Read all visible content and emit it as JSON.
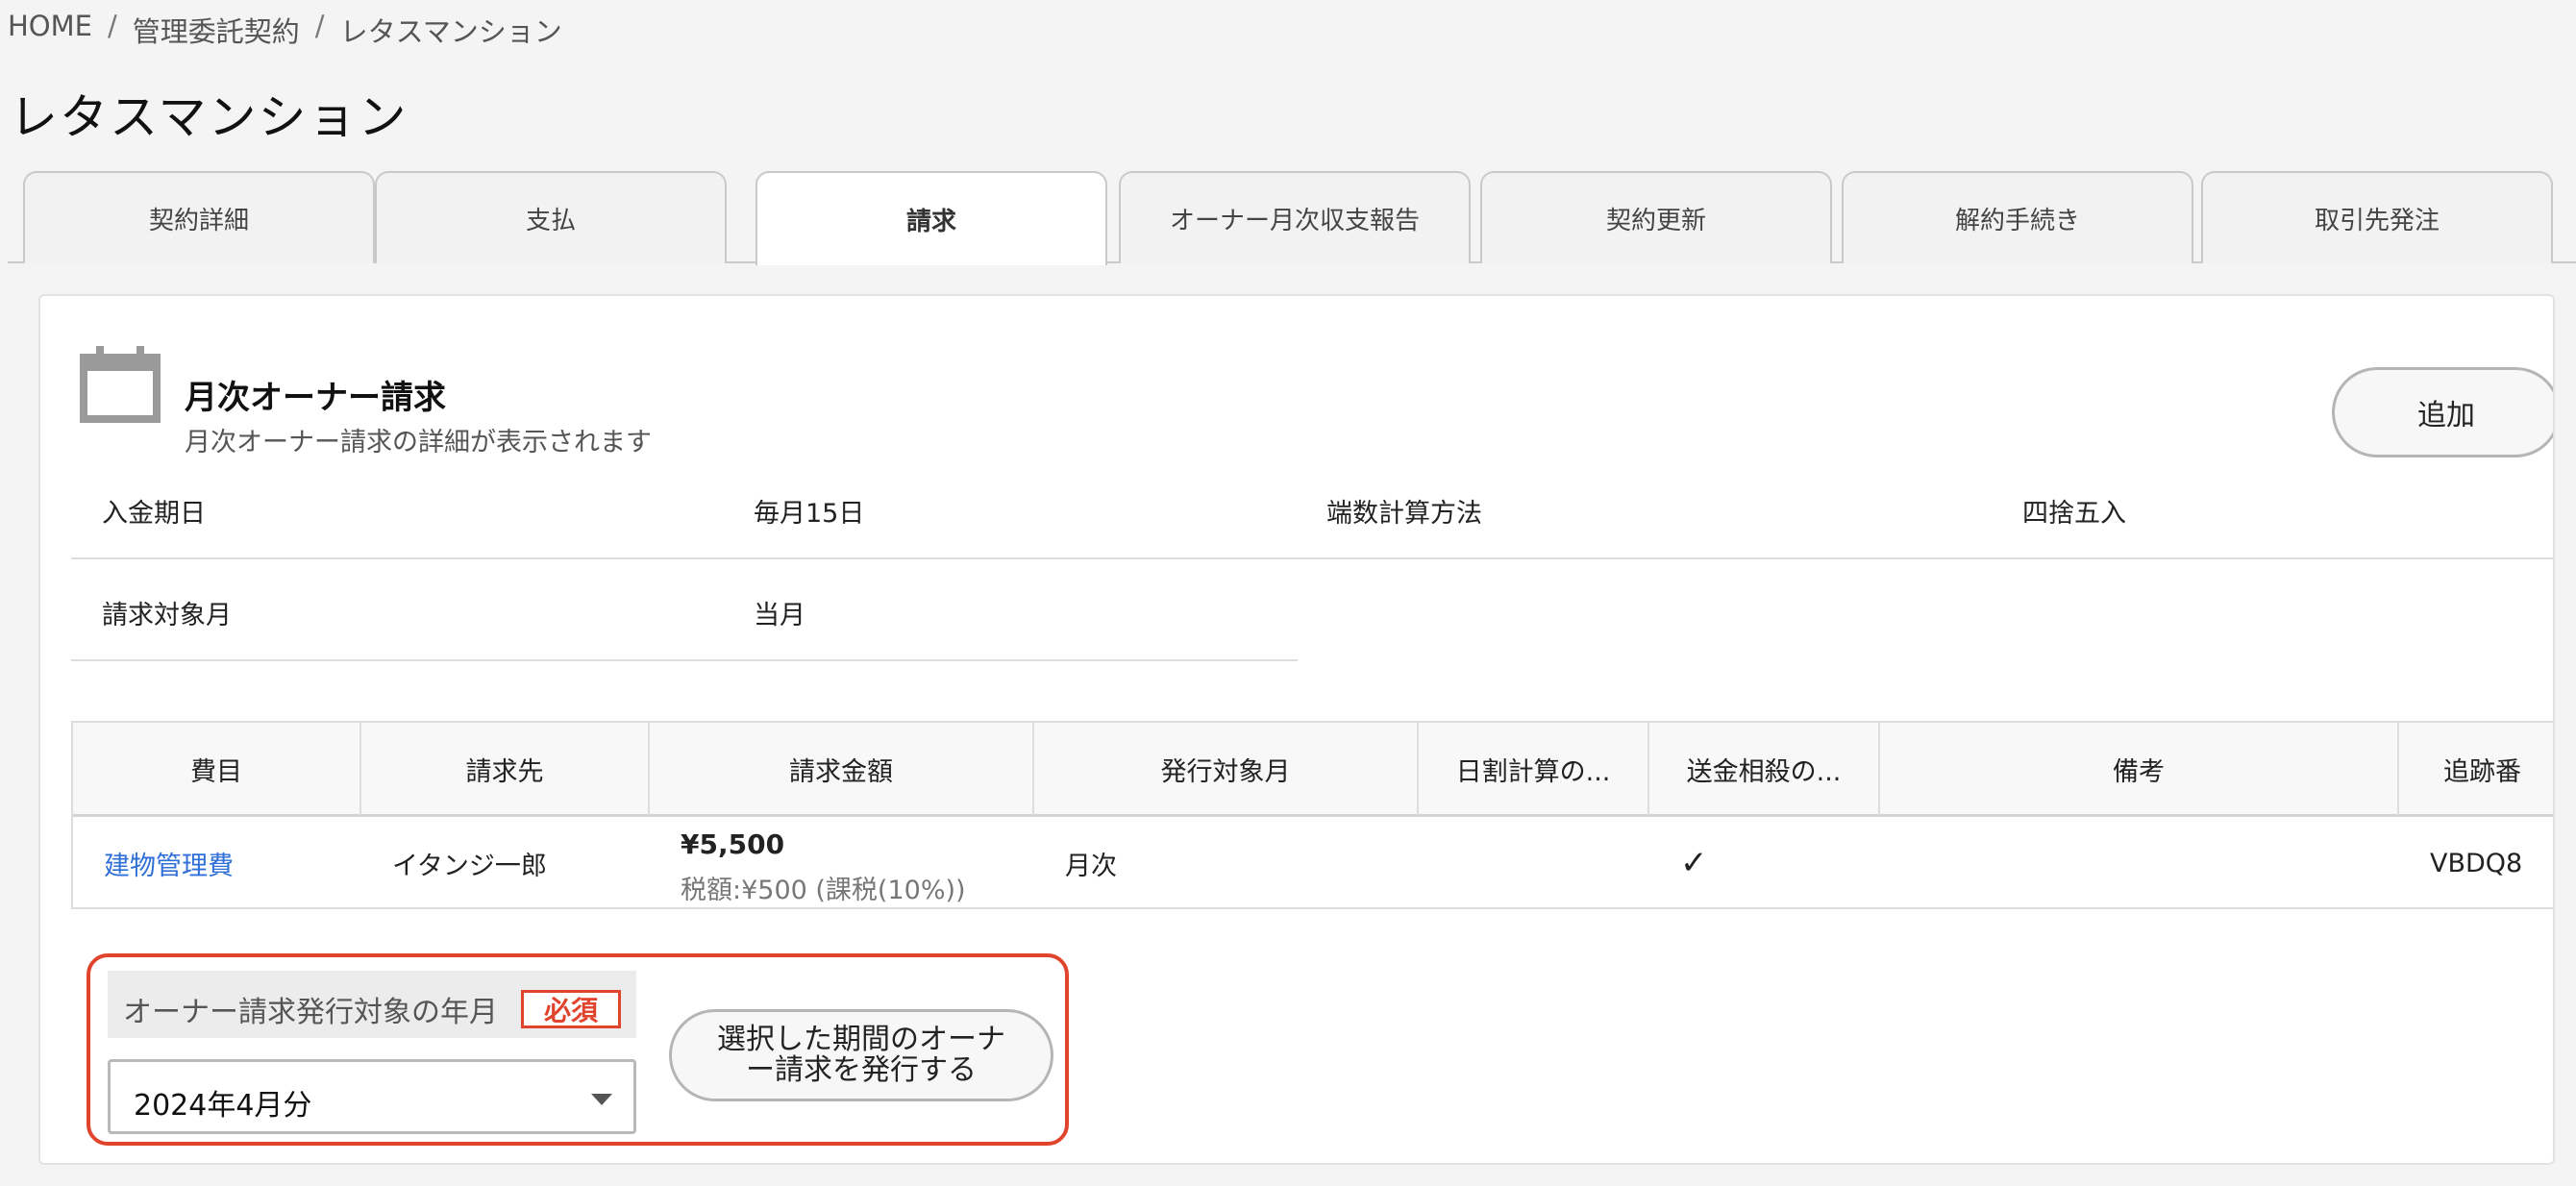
{
  "breadcrumb": {
    "home": "HOME",
    "separator": "/",
    "level1": "管理委託契約",
    "current": "レタスマンション"
  },
  "page_title": "レタスマンション",
  "tabs": [
    {
      "label": "契約詳細",
      "active": false
    },
    {
      "label": "支払",
      "active": false
    },
    {
      "label": "請求",
      "active": true
    },
    {
      "label": "オーナー月次収支報告",
      "active": false
    },
    {
      "label": "契約更新",
      "active": false
    },
    {
      "label": "解約手続き",
      "active": false
    },
    {
      "label": "取引先発注",
      "active": false
    }
  ],
  "card": {
    "icon": "calendar-icon",
    "title": "月次オーナー請求",
    "subtitle": "月次オーナー請求の詳細が表示されます",
    "add_button": "追加"
  },
  "info": {
    "payment_date_label": "入金期日",
    "payment_date_value": "毎月15日",
    "rounding_label": "端数計算方法",
    "rounding_value": "四捨五入",
    "billing_month_label": "請求対象月",
    "billing_month_value": "当月"
  },
  "table": {
    "headers": [
      "費目",
      "請求先",
      "請求金額",
      "発行対象月",
      "日割計算の...",
      "送金相殺の...",
      "備考",
      "追跡番"
    ],
    "rows": [
      {
        "item": "建物管理費",
        "billed_to": "イタンジ一郎",
        "amount": "¥5,500",
        "tax": "税額:¥500 (課税(10%))",
        "target_month": "月次",
        "prorate": "",
        "offset": "✓",
        "note": "",
        "tracking": "VBDQ8"
      }
    ]
  },
  "issue_form": {
    "label": "オーナー請求発行対象の年月",
    "required": "必須",
    "selected_period": "2024年4月分",
    "button_line1": "選択した期間のオーナ",
    "button_line2": "ー請求を発行する",
    "accent_color": "#e0442d"
  },
  "colors": {
    "link": "#2f6fd8",
    "background": "#f4f4f4"
  }
}
